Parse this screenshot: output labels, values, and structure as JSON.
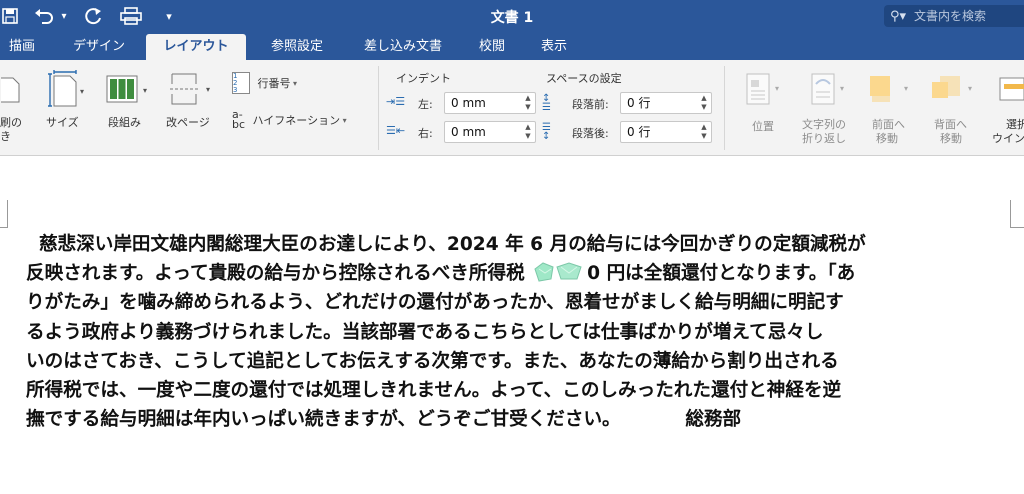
{
  "window": {
    "title": "文書 1",
    "search_placeholder": "文書内を検索"
  },
  "qat": {
    "undo_caret": "▾",
    "more": "▾"
  },
  "tabs": [
    {
      "label": "描画"
    },
    {
      "label": "デザイン"
    },
    {
      "label": "レイアウト",
      "active": true
    },
    {
      "label": "参照設定"
    },
    {
      "label": "差し込み文書"
    },
    {
      "label": "校閲"
    },
    {
      "label": "表示"
    }
  ],
  "ribbon": {
    "orientation_label_1": "刷の",
    "orientation_label_2": "き",
    "size_label": "サイズ",
    "columns_label": "段組み",
    "breaks_label": "改ページ",
    "line_numbers_label": "行番号",
    "hyphenation_label": "ハイフネーション",
    "indent_header": "インデント",
    "spacing_header": "スペースの設定",
    "indent_left_label": "左:",
    "indent_left_value": "0 mm",
    "indent_right_label": "右:",
    "indent_right_value": "0 mm",
    "space_before_label": "段落前:",
    "space_before_value": "0 行",
    "space_after_label": "段落後:",
    "space_after_value": "0 行",
    "position_label": "位置",
    "wrap_text_label_1": "文字列の",
    "wrap_text_label_2": "折り返し",
    "bring_forward_label_1": "前面へ",
    "bring_forward_label_2": "移動",
    "send_backward_label_1": "背面へ",
    "send_backward_label_2": "移動",
    "selection_pane_label_1": "選択",
    "selection_pane_label_2": "ウイン"
  },
  "document": {
    "line1": "  慈悲深い岸田文雄内閣総理大臣のお達しにより、2024 年 6 月の給与には今回かぎりの定額減税が",
    "line2_pre": "反映されます。よって貴殿の給与から控除されるべき所得税 ",
    "line2_post": "0 円は全額還付となります。「あ",
    "line3": "りがたみ」を噛み締められるよう、どれだけの還付があったか、恩着せがましく給与明細に明記す",
    "line4": "るよう政府より義務づけられました。当該部署であるこちらとしては仕事ばかりが増えて忌々し",
    "line5": "いのはさておき、こうして追記としてお伝えする次第です。また、あなたの薄給から割り出される",
    "line6": "所得税では、一度や二度の還付では処理しきれません。よって、このしみったれた還付と神経を逆",
    "line7": "撫でする給与明細は年内いっぱい続きますが、どうぞご甘受ください。          総務部"
  }
}
